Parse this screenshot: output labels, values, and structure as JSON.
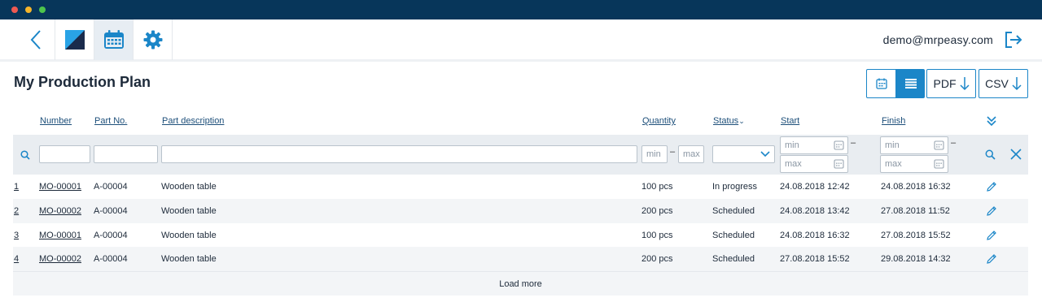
{
  "window": {
    "controls": [
      "close",
      "minimize",
      "maximize"
    ]
  },
  "appbar": {
    "icons": [
      "back-chevron-icon",
      "app-logo-icon",
      "calendar-icon",
      "gear-icon"
    ],
    "user_email": "demo@mrpeasy.com",
    "logout_icon": "logout-icon"
  },
  "page": {
    "title": "My Production Plan"
  },
  "toolbar": {
    "view_calendar_icon": "calendar-icon",
    "view_list_icon": "list-icon",
    "pdf_label": "PDF",
    "csv_label": "CSV"
  },
  "table": {
    "columns": {
      "number": "Number",
      "part_no": "Part No.",
      "part_description": "Part description",
      "quantity": "Quantity",
      "status": "Status",
      "start": "Start",
      "finish": "Finish"
    },
    "filters": {
      "quantity_min_placeholder": "min",
      "quantity_max_placeholder": "max",
      "start_min_placeholder": "min",
      "start_max_placeholder": "max",
      "finish_min_placeholder": "min",
      "finish_max_placeholder": "max",
      "range_separator": "–"
    },
    "rows": [
      {
        "idx": "1",
        "number": "MO-00001",
        "part_no": "A-00004",
        "description": "Wooden table",
        "quantity": "100 pcs",
        "status": "In progress",
        "start": "24.08.2018 12:42",
        "finish": "24.08.2018 16:32"
      },
      {
        "idx": "2",
        "number": "MO-00002",
        "part_no": "A-00004",
        "description": "Wooden table",
        "quantity": "200 pcs",
        "status": "Scheduled",
        "start": "24.08.2018 13:42",
        "finish": "27.08.2018 11:52"
      },
      {
        "idx": "3",
        "number": "MO-00001",
        "part_no": "A-00004",
        "description": "Wooden table",
        "quantity": "100 pcs",
        "status": "Scheduled",
        "start": "24.08.2018 16:32",
        "finish": "27.08.2018 15:52"
      },
      {
        "idx": "4",
        "number": "MO-00002",
        "part_no": "A-00004",
        "description": "Wooden table",
        "quantity": "200 pcs",
        "status": "Scheduled",
        "start": "27.08.2018 15:52",
        "finish": "29.08.2018 14:32"
      }
    ],
    "load_more": "Load more"
  },
  "colors": {
    "titlebar": "#07365a",
    "accent": "#1b86c8",
    "text": "#1d2a3a",
    "filter_bg": "#e9edf1"
  }
}
